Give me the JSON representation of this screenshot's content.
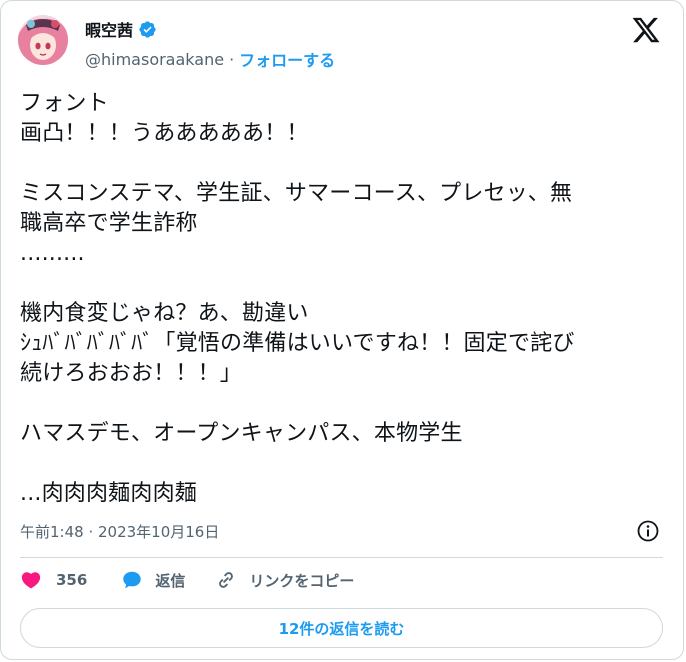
{
  "author": {
    "display_name": "暇空茜",
    "handle": "@himasoraakane",
    "separator": "·",
    "follow_label": "フォローする"
  },
  "tweet": {
    "text": "フォント\n画凸！！！うあああああ！！\n\nミスコンステマ、学生証、サマーコース、プレセッ、無\n職高卒で学生詐称\n.........\n\n機内食変じゃね？あ、勘違い\nｼｭﾊﾞﾊﾞﾊﾞﾊﾞﾊﾞ「覚悟の準備はいいですね！！固定で詫び\n続けろおおお！！！」\n\nハマスデモ、オープンキャンパス、本物学生\n\n...肉肉肉麺肉肉麺"
  },
  "timestamp": "午前1:48 · 2023年10月16日",
  "actions": {
    "like_count": "356",
    "reply_label": "返信",
    "copy_link_label": "リンクをコピー"
  },
  "read_replies_label": "12件の返信を読む",
  "colors": {
    "accent": "#1d9bf0",
    "like": "#f91880",
    "text": "#0f1419",
    "secondary": "#536471",
    "border": "#cfd9de"
  },
  "icons": {
    "verified": "verified-badge-icon",
    "logo": "x-logo-icon",
    "info": "info-icon",
    "like": "heart-icon",
    "reply": "speech-bubble-icon",
    "link": "link-icon"
  }
}
